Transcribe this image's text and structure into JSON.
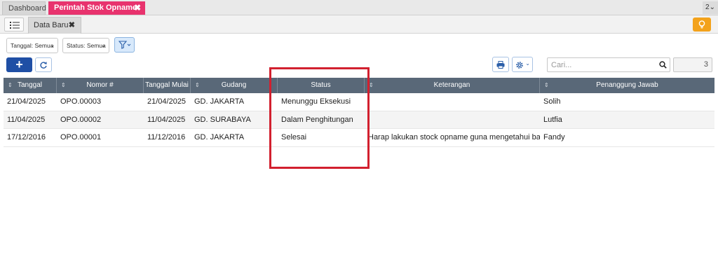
{
  "top_tabs": {
    "dashboard": "Dashboard",
    "active": "Perintah Stok Opname",
    "close": "✖",
    "right_counter": "2⌄"
  },
  "sub_tabs": {
    "active": "Data Baru",
    "close": "✖"
  },
  "filters": {
    "tanggal": "Tanggal: Semua",
    "status": "Status: Semua"
  },
  "actions": {
    "add_label": "+",
    "search_placeholder": "Cari...",
    "page_value": "3"
  },
  "table": {
    "columns": [
      "Tanggal",
      "Nomor #",
      "Tanggal Mulai",
      "Gudang",
      "Status",
      "Keterangan",
      "Penanggung Jawab"
    ],
    "rows": [
      [
        "21/04/2025",
        "OPO.00003",
        "21/04/2025",
        "GD. JAKARTA",
        "Menunggu Eksekusi",
        "",
        "Solih"
      ],
      [
        "11/04/2025",
        "OPO.00002",
        "11/04/2025",
        "GD. SURABAYA",
        "Dalam Penghitungan",
        "",
        "Lutfia"
      ],
      [
        "17/12/2016",
        "OPO.00001",
        "11/12/2016",
        "GD. JAKARTA",
        "Selesai",
        "Harap lakukan stock opname guna mengetahui bara...",
        "Fandy"
      ]
    ]
  },
  "colors": {
    "active_tab": "#e8336e",
    "header": "#596878",
    "primary": "#1f4fa5",
    "highlight": "#d2202f",
    "bulb": "#f3a21b"
  },
  "icons": [
    "list-icon",
    "lightbulb-icon",
    "filter-icon",
    "refresh-icon",
    "printer-icon",
    "gear-icon",
    "search-icon",
    "sort-icon"
  ]
}
